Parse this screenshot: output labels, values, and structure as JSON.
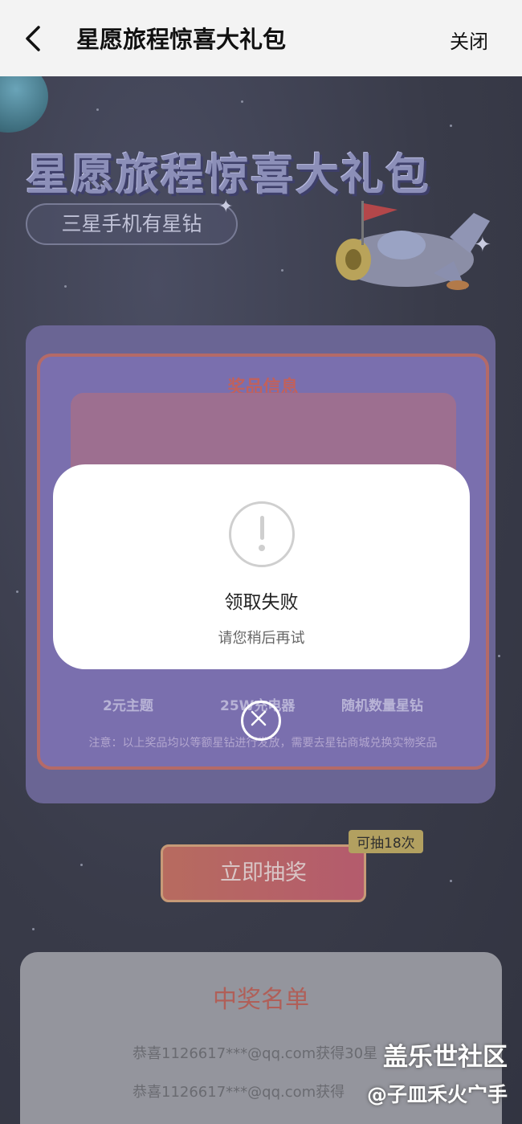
{
  "header": {
    "title": "星愿旅程惊喜大礼包",
    "close_label": "关闭"
  },
  "hero": {
    "title": "星愿旅程惊喜大礼包",
    "subtitle": "三星手机有星钻"
  },
  "prize": {
    "heading": "奖品信息",
    "items": [
      "2元主题",
      "25W充电器",
      "随机数量星钻"
    ],
    "note": "注意：以上奖品均以等额星钻进行发放，需要去星钻商城兑换实物奖品"
  },
  "draw": {
    "button_label": "立即抽奖",
    "badge": "可抽18次"
  },
  "winners": {
    "heading": "中奖名单",
    "rows": [
      "恭喜1126617***@qq.com获得30星",
      "恭喜1126617***@qq.com获得"
    ]
  },
  "dialog": {
    "title": "领取失败",
    "message": "请您稍后再试",
    "icon": "exclamation-icon"
  },
  "watermark": {
    "line1": "盖乐世社区",
    "line2": "@子皿禾火宀手"
  },
  "colors": {
    "dialog_bg": "#ffffff",
    "page_bg": "#3a3d4c",
    "accent_red": "#c0615d"
  }
}
